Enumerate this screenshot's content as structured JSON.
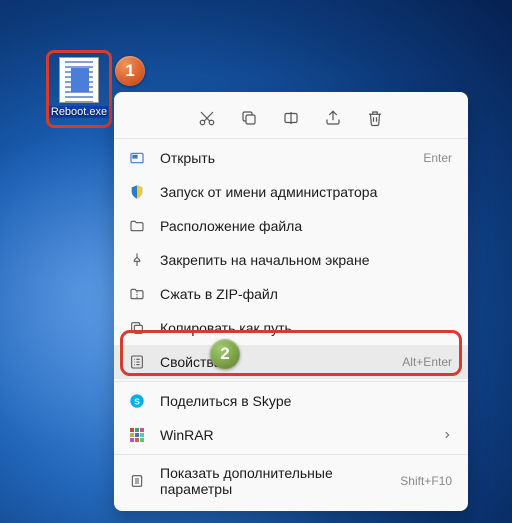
{
  "desktop": {
    "icon_label": "Reboot.exe"
  },
  "badges": {
    "one": "1",
    "two": "2"
  },
  "menu": {
    "open": {
      "label": "Открыть",
      "shortcut": "Enter"
    },
    "run_admin": {
      "label": "Запуск от имени администратора"
    },
    "file_location": {
      "label": "Расположение файла"
    },
    "pin_start": {
      "label": "Закрепить на начальном экране"
    },
    "compress_zip": {
      "label": "Сжать в ZIP-файл"
    },
    "copy_path": {
      "label": "Копировать как путь"
    },
    "properties": {
      "label": "Свойства",
      "shortcut": "Alt+Enter"
    },
    "share_skype": {
      "label": "Поделиться в Skype"
    },
    "winrar": {
      "label": "WinRAR"
    },
    "more_options": {
      "label": "Показать дополнительные параметры",
      "shortcut": "Shift+F10"
    }
  }
}
